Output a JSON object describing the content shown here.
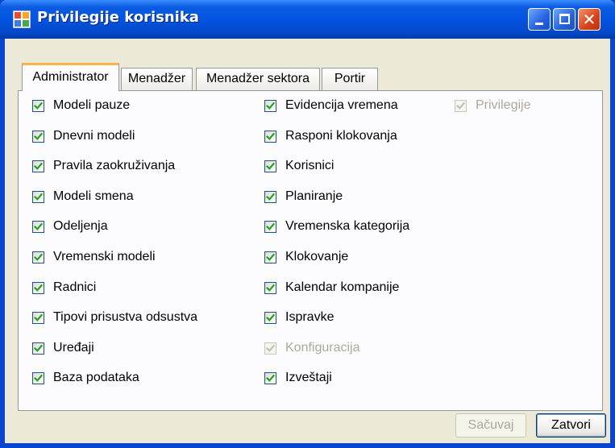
{
  "window": {
    "title": "Privilegije korisnika"
  },
  "tabs": [
    {
      "label": "Administrator",
      "active": true
    },
    {
      "label": "Menadžer",
      "active": false
    },
    {
      "label": "Menadžer sektora",
      "active": false
    },
    {
      "label": "Portir",
      "active": false
    }
  ],
  "privileges": {
    "column1": [
      {
        "label": "Modeli pauze",
        "checked": true,
        "enabled": true
      },
      {
        "label": "Dnevni modeli",
        "checked": true,
        "enabled": true
      },
      {
        "label": "Pravila zaokruživanja",
        "checked": true,
        "enabled": true
      },
      {
        "label": "Modeli smena",
        "checked": true,
        "enabled": true
      },
      {
        "label": "Odeljenja",
        "checked": true,
        "enabled": true
      },
      {
        "label": "Vremenski modeli",
        "checked": true,
        "enabled": true
      },
      {
        "label": "Radnici",
        "checked": true,
        "enabled": true
      },
      {
        "label": "Tipovi prisustva odsustva",
        "checked": true,
        "enabled": true
      },
      {
        "label": "Uređaji",
        "checked": true,
        "enabled": true
      },
      {
        "label": "Baza podataka",
        "checked": true,
        "enabled": true
      }
    ],
    "column2": [
      {
        "label": "Evidencija vremena",
        "checked": true,
        "enabled": true
      },
      {
        "label": "Rasponi klokovanja",
        "checked": true,
        "enabled": true
      },
      {
        "label": "Korisnici",
        "checked": true,
        "enabled": true
      },
      {
        "label": "Planiranje",
        "checked": true,
        "enabled": true
      },
      {
        "label": "Vremenska kategorija",
        "checked": true,
        "enabled": true
      },
      {
        "label": "Klokovanje",
        "checked": true,
        "enabled": true
      },
      {
        "label": "Kalendar kompanije",
        "checked": true,
        "enabled": true
      },
      {
        "label": "Ispravke",
        "checked": true,
        "enabled": true
      },
      {
        "label": "Konfiguracija",
        "checked": true,
        "enabled": false
      },
      {
        "label": "Izveštaji",
        "checked": true,
        "enabled": true
      }
    ],
    "column3": [
      {
        "label": "Privilegije",
        "checked": true,
        "enabled": false
      }
    ]
  },
  "buttons": {
    "save_label": "Sačuvaj",
    "close_label": "Zatvori"
  },
  "colors": {
    "titlebar": "#0454E3",
    "check_enabled": "#21A121",
    "check_disabled": "#C2C0B4",
    "tab_active_accent": "#F7B548"
  }
}
